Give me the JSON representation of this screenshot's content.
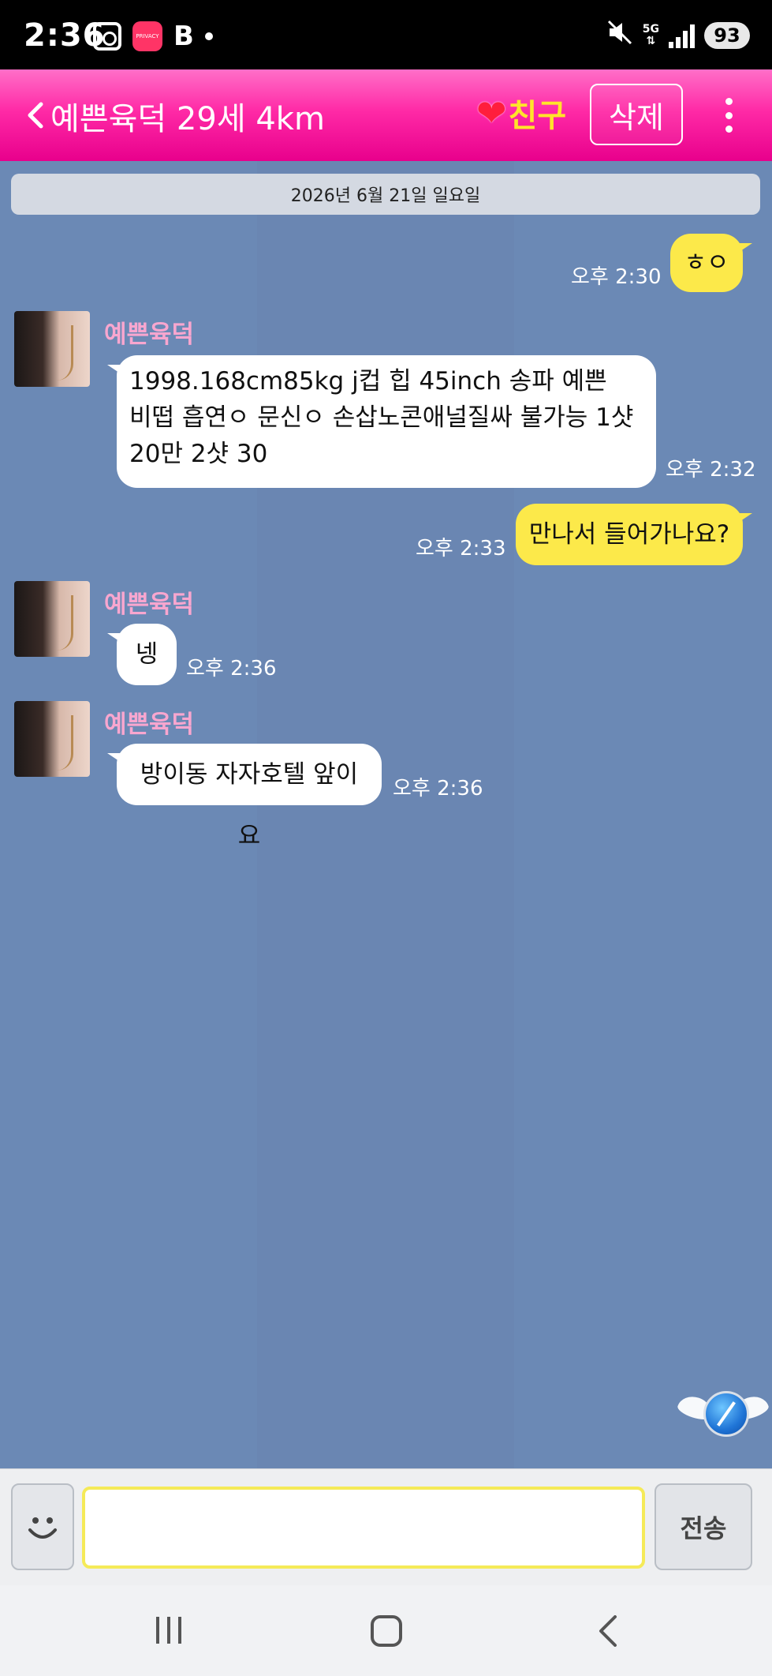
{
  "status_bar": {
    "time": "2:36",
    "app_badge": "PRIVACY",
    "letter_icon": "B",
    "network": "5G",
    "battery": "93",
    "icons": [
      "screenshot-icon",
      "app-icon",
      "mute-icon",
      "signal-icon",
      "battery-icon"
    ]
  },
  "header": {
    "title": "예쁜육덕 29세 4km",
    "heart": "❤",
    "friend_label": "친구",
    "delete_label": "삭제"
  },
  "chat": {
    "date": "2026년 6월 21일 일요일",
    "sender_name": "예쁜육덕",
    "messages": [
      {
        "from": "me",
        "text": "ㅎㅇ",
        "time": "오후 2:30"
      },
      {
        "from": "them",
        "lines": [
          "1998.168cm85kg j컵 힙 45inch  송파 예쁜",
          "비떱  흡연ㅇ 문신ㅇ 손삽노콘애널질싸 불가능 1샷",
          "20만 2샷 30"
        ],
        "time": "오후 2:32"
      },
      {
        "from": "me",
        "text": "만나서 들어가나요?",
        "time": "오후 2:33"
      },
      {
        "from": "them",
        "text": "넹",
        "time": "오후 2:36"
      },
      {
        "from": "them",
        "text": "방이동 자자호텔 앞이요",
        "time": "오후 2:36"
      }
    ]
  },
  "input": {
    "placeholder": "",
    "value": "",
    "send_label": "전송"
  },
  "colors": {
    "header_pink": "#ff2aa6",
    "friend_yellow": "#ffe42a",
    "chat_bg": "#6b89b5",
    "my_bubble": "#fce94a",
    "sender_name": "#f8a6cf"
  }
}
